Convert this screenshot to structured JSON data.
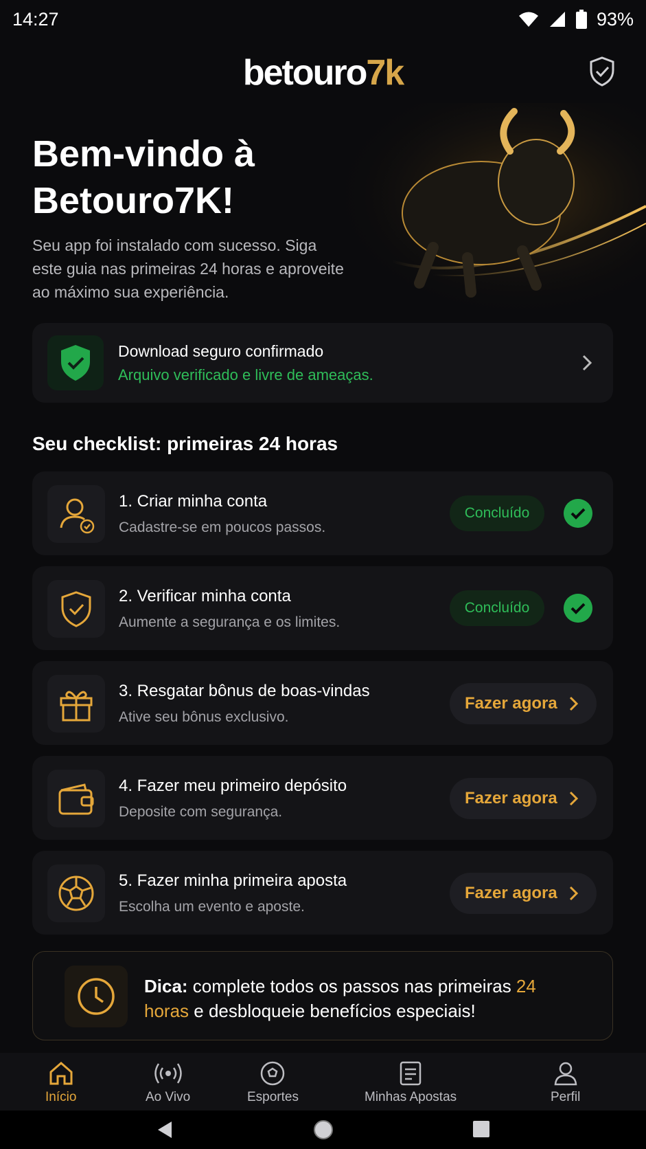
{
  "status": {
    "time": "14:27",
    "battery": "93%"
  },
  "header": {
    "logo_main": "betouro",
    "logo_accent": "7k"
  },
  "hero": {
    "title": "Bem-vindo à Betouro7K!",
    "subtitle": "Seu app foi instalado com sucesso. Siga este guia nas primeiras 24 horas e aproveite ao máximo sua experiência."
  },
  "secure": {
    "title": "Download seguro confirmado",
    "subtitle": "Arquivo verificado e livre de ameaças."
  },
  "checklist": {
    "title": "Seu checklist: primeiras 24 horas",
    "items": [
      {
        "title": "1. Criar minha conta",
        "desc": "Cadastre-se em poucos passos.",
        "status": "Concluído",
        "icon": "user-check-icon"
      },
      {
        "title": "2. Verificar minha conta",
        "desc": "Aumente a segurança e os limites.",
        "status": "Concluído",
        "icon": "shield-check-icon"
      },
      {
        "title": "3. Resgatar bônus de boas-vindas",
        "desc": "Ative seu bônus exclusivo.",
        "action": "Fazer agora",
        "icon": "gift-icon"
      },
      {
        "title": "4. Fazer meu primeiro depósito",
        "desc": "Deposite com segurança.",
        "action": "Fazer agora",
        "icon": "wallet-icon"
      },
      {
        "title": "5. Fazer minha primeira aposta",
        "desc": "Escolha um evento e aposte.",
        "action": "Fazer agora",
        "icon": "soccer-ball-icon"
      }
    ]
  },
  "tip": {
    "label": "Dica:",
    "text1": " complete todos os passos nas primeiras ",
    "highlight": "24 horas",
    "text2": " e desbloqueie benefícios especiais!"
  },
  "nav": {
    "items": [
      "Início",
      "Ao Vivo",
      "Esportes",
      "Minhas Apostas",
      "Perfil"
    ]
  },
  "colors": {
    "gold": "#e5a73a",
    "green": "#2fbd59",
    "background": "#0b0b0d"
  }
}
